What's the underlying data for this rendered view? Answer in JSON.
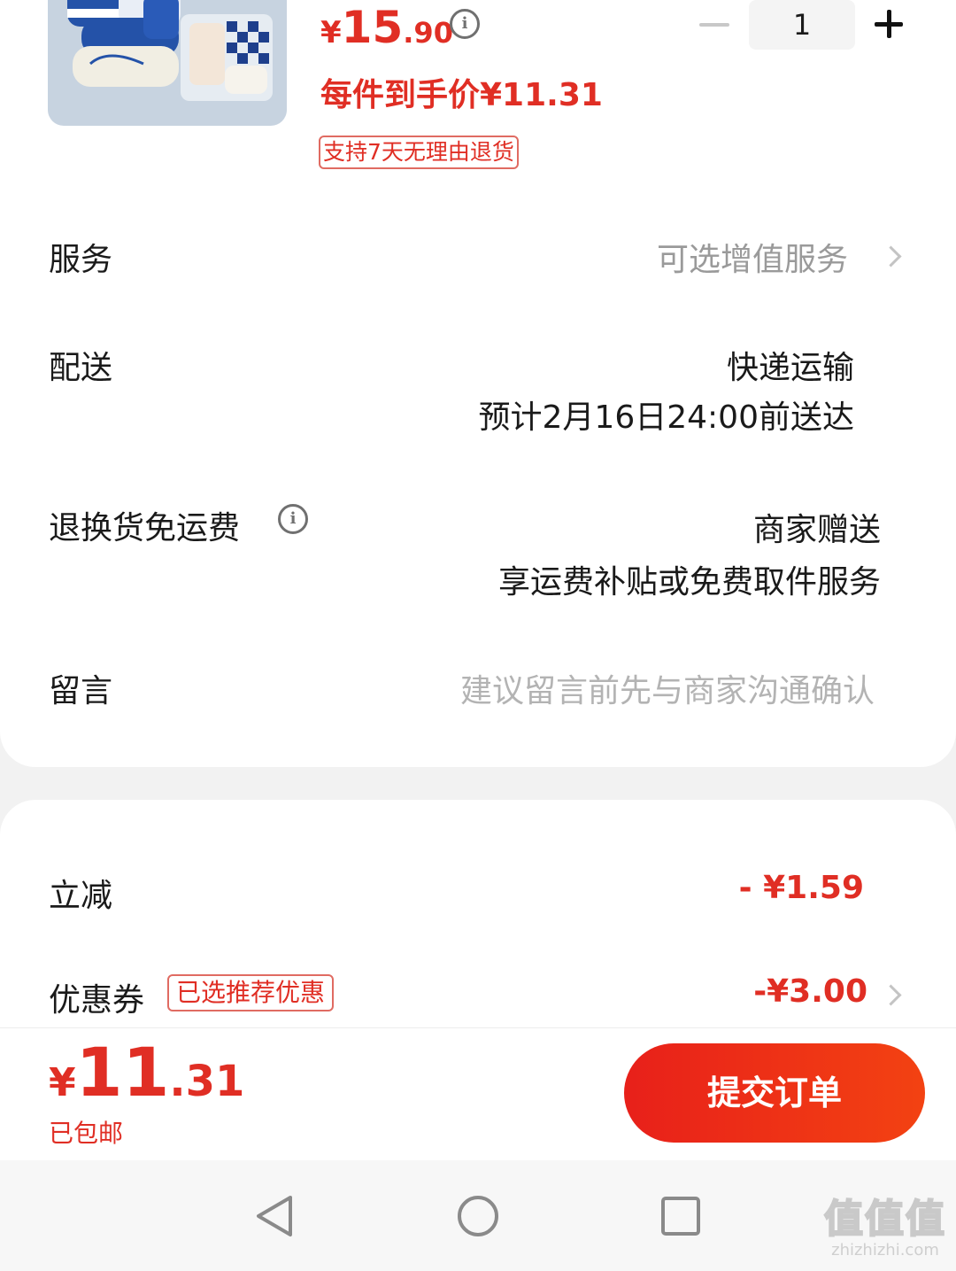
{
  "product": {
    "price_symbol": "¥",
    "price_integer": "15",
    "price_decimal": ".90",
    "unit_price": "每件到手价¥11.31",
    "return_tag": "支持7天无理由退货",
    "quantity": "1"
  },
  "rows": {
    "service_label": "服务",
    "service_value": "可选增值服务",
    "delivery_label": "配送",
    "delivery_method": "快递运输",
    "delivery_eta": "预计2月16日24:00前送达",
    "return_shipping_label": "退换货免运费",
    "return_shipping_value": "商家赠送",
    "return_shipping_detail": "享运费补贴或免费取件服务",
    "message_label": "留言",
    "message_placeholder": "建议留言前先与商家沟通确认"
  },
  "discounts": {
    "instant_label": "立减",
    "instant_value": "- ¥1.59",
    "coupon_label": "优惠券",
    "coupon_tag": "已选推荐优惠",
    "coupon_value": "-¥3.00"
  },
  "footer": {
    "total_symbol": "¥",
    "total_integer": "11",
    "total_decimal": ".31",
    "shipping_note": "已包邮",
    "submit_label": "提交订单"
  },
  "watermark": {
    "logo": "值值值",
    "url": "zhizhizhi.com"
  },
  "colors": {
    "accent": "#e02e24",
    "button_start": "#e8201a",
    "button_end": "#f34212"
  }
}
